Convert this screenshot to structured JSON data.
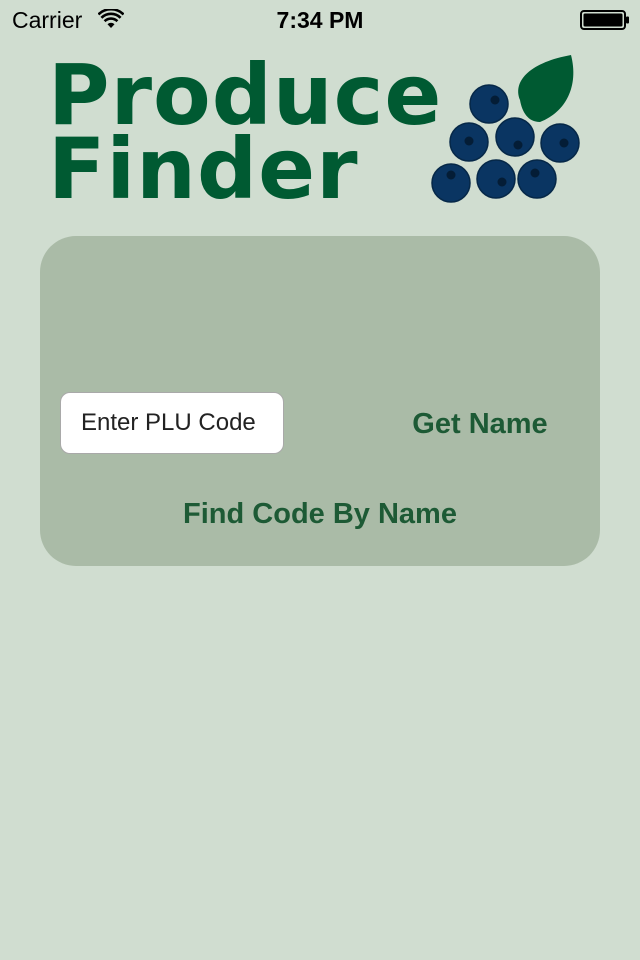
{
  "status_bar": {
    "carrier": "Carrier",
    "time": "7:34 PM",
    "wifi_icon": "wifi-icon",
    "battery_icon": "battery-full-icon"
  },
  "header": {
    "title_line1": "Produce",
    "title_line2": "Finder",
    "logo_icon": "blueberries-with-leaf-icon"
  },
  "form": {
    "plu_input_value": "",
    "plu_input_placeholder": "Enter PLU Code",
    "get_name_label": "Get Name",
    "find_by_name_label": "Find Code By Name"
  },
  "colors": {
    "background": "#d0ddd0",
    "panel": "#aabba7",
    "brand_green": "#005a32",
    "button_text": "#1d5a35",
    "berry": "#0a3562"
  }
}
